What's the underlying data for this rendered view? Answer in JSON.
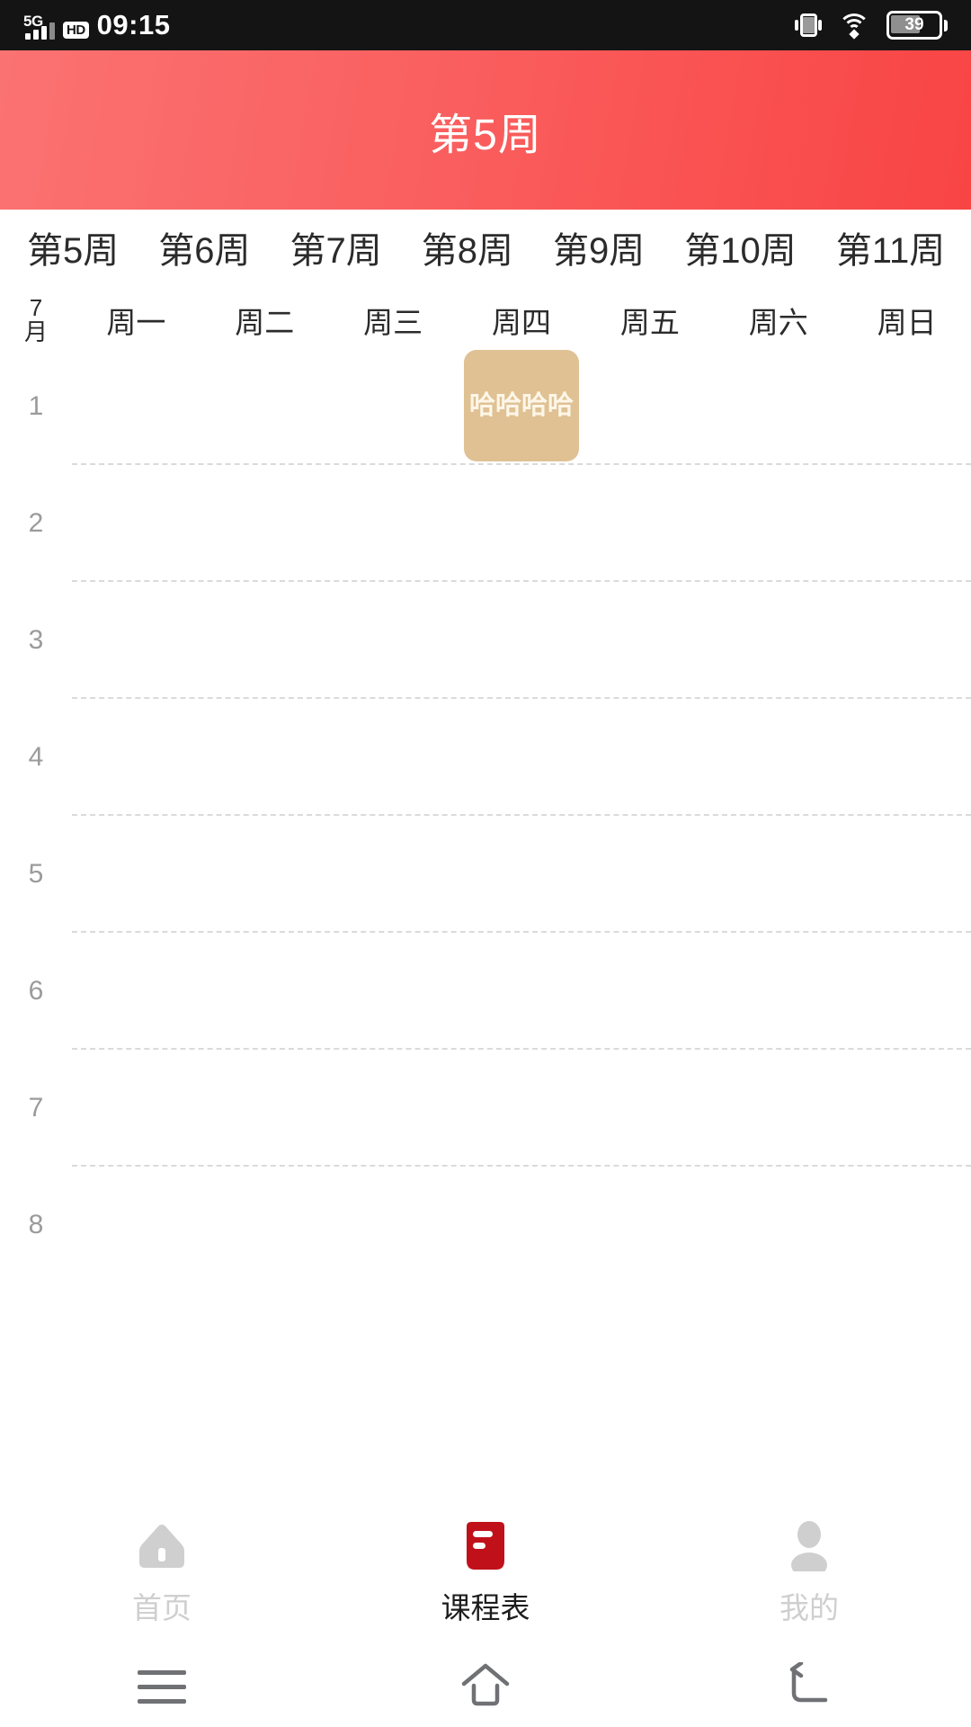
{
  "statusbar": {
    "network_label": "5G",
    "hd_label": "HD",
    "time": "09:15",
    "battery_level": "39",
    "signal_icon": "signal-bars-icon",
    "vibrate_icon": "vibrate-icon",
    "wifi_icon": "wifi-icon",
    "battery_icon": "battery-icon"
  },
  "appbar": {
    "title": "第5周",
    "gradient_from": "#fb7272",
    "gradient_to": "#f94444"
  },
  "week_tabs": {
    "selected": "第5周",
    "items": [
      {
        "label": "第5周"
      },
      {
        "label": "第6周"
      },
      {
        "label": "第7周"
      },
      {
        "label": "第8周"
      },
      {
        "label": "第9周"
      },
      {
        "label": "第10周"
      },
      {
        "label": "第11周"
      }
    ]
  },
  "day_header": {
    "month_number": "7",
    "month_unit": "月",
    "days": [
      {
        "label": "周一"
      },
      {
        "label": "周二"
      },
      {
        "label": "周三"
      },
      {
        "label": "周四"
      },
      {
        "label": "周五"
      },
      {
        "label": "周六"
      },
      {
        "label": "周日"
      }
    ]
  },
  "grid": {
    "periods": [
      {
        "label": "1"
      },
      {
        "label": "2"
      },
      {
        "label": "3"
      },
      {
        "label": "4"
      },
      {
        "label": "5"
      },
      {
        "label": "6"
      },
      {
        "label": "7"
      },
      {
        "label": "8"
      }
    ]
  },
  "courses": [
    {
      "title": "哈哈哈哈",
      "day_index": 4,
      "period_start": 1,
      "period_span": 1,
      "color": "#dfc193",
      "text_color": "#fdf6e8"
    }
  ],
  "tabbar": {
    "items": [
      {
        "label": "首页",
        "icon": "home-icon",
        "active": false
      },
      {
        "label": "课程表",
        "icon": "schedule-book-icon",
        "active": true
      },
      {
        "label": "我的",
        "icon": "user-profile-icon",
        "active": false
      }
    ],
    "active_color": "#c0111b",
    "inactive_color": "#cfcfcf"
  },
  "android_nav": {
    "items": [
      {
        "icon": "menu-icon"
      },
      {
        "icon": "home-icon"
      },
      {
        "icon": "back-icon"
      }
    ]
  }
}
